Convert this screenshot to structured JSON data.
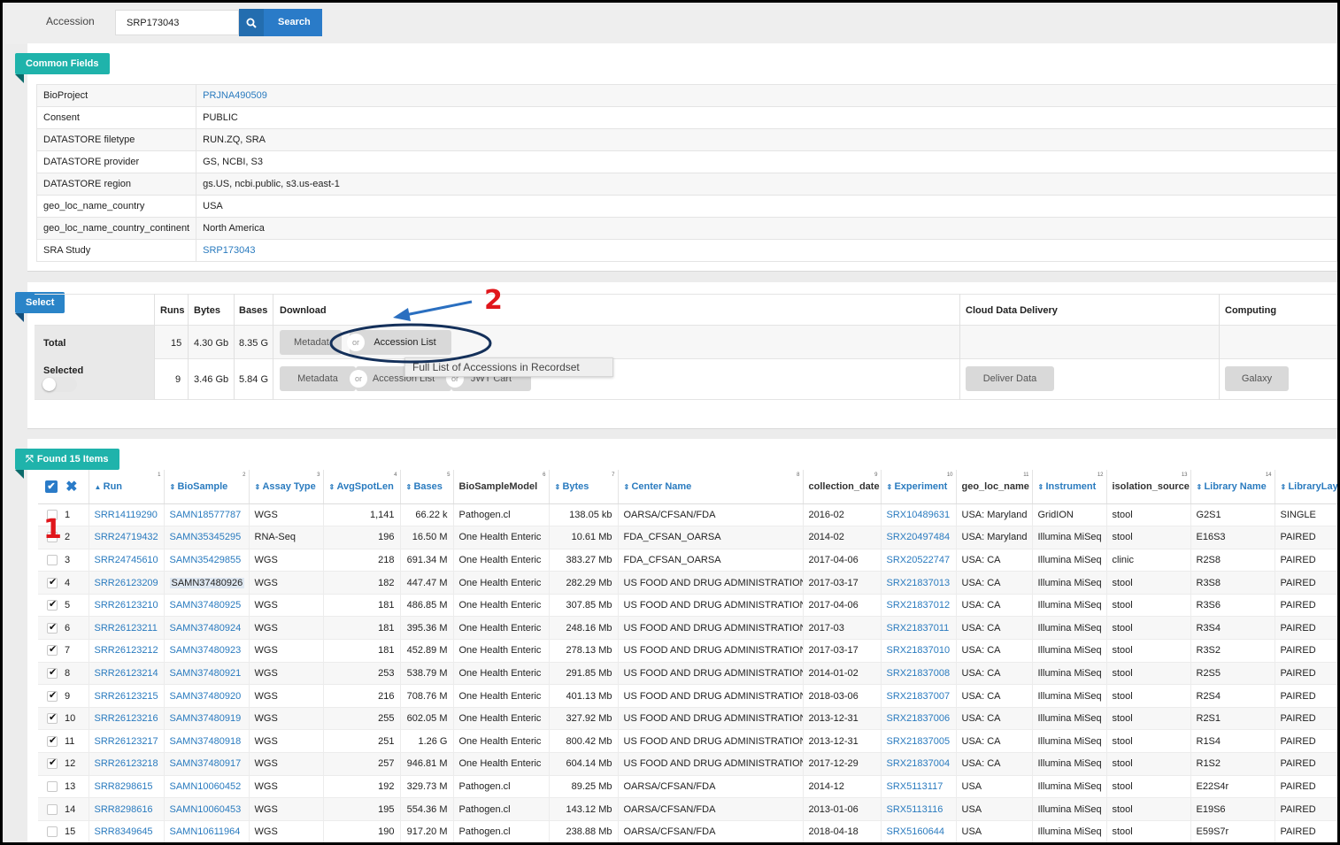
{
  "search": {
    "label": "Accession",
    "value": "SRP173043",
    "button": "Search"
  },
  "common_fields": {
    "title": "Common Fields",
    "rows": [
      {
        "key": "BioProject",
        "value": "PRJNA490509",
        "link": true
      },
      {
        "key": "Consent",
        "value": "PUBLIC",
        "link": false
      },
      {
        "key": "DATASTORE filetype",
        "value": "RUN.ZQ, SRA",
        "link": false
      },
      {
        "key": "DATASTORE provider",
        "value": "GS, NCBI, S3",
        "link": false
      },
      {
        "key": "DATASTORE region",
        "value": "gs.US, ncbi.public, s3.us-east-1",
        "link": false
      },
      {
        "key": "geo_loc_name_country",
        "value": "USA",
        "link": false
      },
      {
        "key": "geo_loc_name_country_continent",
        "value": "North America",
        "link": false
      },
      {
        "key": "SRA Study",
        "value": "SRP173043",
        "link": true
      }
    ]
  },
  "select": {
    "title": "Select",
    "headers": {
      "runs": "Runs",
      "bytes": "Bytes",
      "bases": "Bases",
      "download": "Download",
      "cloud": "Cloud Data Delivery",
      "computing": "Computing"
    },
    "total": {
      "label": "Total",
      "runs": "15",
      "bytes": "4.30 Gb",
      "bases": "8.35 G"
    },
    "selected": {
      "label": "Selected",
      "runs": "9",
      "bytes": "3.46 Gb",
      "bases": "5.84 G"
    },
    "buttons": {
      "metadata_total": "Metadat",
      "accession_total": "Accession List",
      "metadata": "Metadata",
      "accession": "Accession List",
      "jwt": "JWT Cart",
      "deliver": "Deliver Data",
      "galaxy": "Galaxy",
      "or": "or"
    },
    "tooltip": "Full List of Accessions in Recordset"
  },
  "annotations": {
    "one": "1",
    "two": "2"
  },
  "results": {
    "title": "Found 15 Items",
    "columns": [
      {
        "label": "Run",
        "n": "1"
      },
      {
        "label": "BioSample",
        "n": "2"
      },
      {
        "label": "Assay Type",
        "n": "3"
      },
      {
        "label": "AvgSpotLen",
        "n": "4"
      },
      {
        "label": "Bases",
        "n": "5"
      },
      {
        "label": "BioSampleModel",
        "n": "6"
      },
      {
        "label": "Bytes",
        "n": "7"
      },
      {
        "label": "Center Name",
        "n": "8"
      },
      {
        "label": "collection_date",
        "n": "9"
      },
      {
        "label": "Experiment",
        "n": "10"
      },
      {
        "label": "geo_loc_name",
        "n": "11"
      },
      {
        "label": "Instrument",
        "n": "12"
      },
      {
        "label": "isolation_source",
        "n": "13"
      },
      {
        "label": "Library Name",
        "n": "14"
      },
      {
        "label": "LibraryLay",
        "n": ""
      }
    ],
    "rows": [
      {
        "i": "1",
        "c": false,
        "run": "SRR14119290",
        "bs": "SAMN18577787",
        "assay": "WGS",
        "avg": "1,141",
        "bases": "66.22 k",
        "model": "Pathogen.cl",
        "bytes": "138.05 kb",
        "center": "OARSA/CFSAN/FDA",
        "date": "2016-02",
        "exp": "SRX10489631",
        "geo": "USA: Maryland",
        "inst": "GridION",
        "iso": "stool",
        "lib": "G2S1",
        "lay": "SINGLE"
      },
      {
        "i": "2",
        "c": false,
        "run": "SRR24719432",
        "bs": "SAMN35345295",
        "assay": "RNA-Seq",
        "avg": "196",
        "bases": "16.50 M",
        "model": "One Health Enteric",
        "bytes": "10.61 Mb",
        "center": "FDA_CFSAN_OARSA",
        "date": "2014-02",
        "exp": "SRX20497484",
        "geo": "USA: Maryland",
        "inst": "Illumina MiSeq",
        "iso": "stool",
        "lib": "E16S3",
        "lay": "PAIRED"
      },
      {
        "i": "3",
        "c": false,
        "run": "SRR24745610",
        "bs": "SAMN35429855",
        "assay": "WGS",
        "avg": "218",
        "bases": "691.34 M",
        "model": "One Health Enteric",
        "bytes": "383.27 Mb",
        "center": "FDA_CFSAN_OARSA",
        "date": "2017-04-06",
        "exp": "SRX20522747",
        "geo": "USA: CA",
        "inst": "Illumina MiSeq",
        "iso": "clinic",
        "lib": "R2S8",
        "lay": "PAIRED"
      },
      {
        "i": "4",
        "c": true,
        "run": "SRR26123209",
        "bs": "SAMN37480926",
        "assay": "WGS",
        "avg": "182",
        "bases": "447.47 M",
        "model": "One Health Enteric",
        "bytes": "282.29 Mb",
        "center": "US FOOD AND DRUG ADMINISTRATION",
        "date": "2017-03-17",
        "exp": "SRX21837013",
        "geo": "USA: CA",
        "inst": "Illumina MiSeq",
        "iso": "stool",
        "lib": "R3S8",
        "lay": "PAIRED"
      },
      {
        "i": "5",
        "c": true,
        "run": "SRR26123210",
        "bs": "SAMN37480925",
        "assay": "WGS",
        "avg": "181",
        "bases": "486.85 M",
        "model": "One Health Enteric",
        "bytes": "307.85 Mb",
        "center": "US FOOD AND DRUG ADMINISTRATION",
        "date": "2017-04-06",
        "exp": "SRX21837012",
        "geo": "USA: CA",
        "inst": "Illumina MiSeq",
        "iso": "stool",
        "lib": "R3S6",
        "lay": "PAIRED"
      },
      {
        "i": "6",
        "c": true,
        "run": "SRR26123211",
        "bs": "SAMN37480924",
        "assay": "WGS",
        "avg": "181",
        "bases": "395.36 M",
        "model": "One Health Enteric",
        "bytes": "248.16 Mb",
        "center": "US FOOD AND DRUG ADMINISTRATION",
        "date": "2017-03",
        "exp": "SRX21837011",
        "geo": "USA: CA",
        "inst": "Illumina MiSeq",
        "iso": "stool",
        "lib": "R3S4",
        "lay": "PAIRED"
      },
      {
        "i": "7",
        "c": true,
        "run": "SRR26123212",
        "bs": "SAMN37480923",
        "assay": "WGS",
        "avg": "181",
        "bases": "452.89 M",
        "model": "One Health Enteric",
        "bytes": "278.13 Mb",
        "center": "US FOOD AND DRUG ADMINISTRATION",
        "date": "2017-03-17",
        "exp": "SRX21837010",
        "geo": "USA: CA",
        "inst": "Illumina MiSeq",
        "iso": "stool",
        "lib": "R3S2",
        "lay": "PAIRED"
      },
      {
        "i": "8",
        "c": true,
        "run": "SRR26123214",
        "bs": "SAMN37480921",
        "assay": "WGS",
        "avg": "253",
        "bases": "538.79 M",
        "model": "One Health Enteric",
        "bytes": "291.85 Mb",
        "center": "US FOOD AND DRUG ADMINISTRATION",
        "date": "2014-01-02",
        "exp": "SRX21837008",
        "geo": "USA: CA",
        "inst": "Illumina MiSeq",
        "iso": "stool",
        "lib": "R2S5",
        "lay": "PAIRED"
      },
      {
        "i": "9",
        "c": true,
        "run": "SRR26123215",
        "bs": "SAMN37480920",
        "assay": "WGS",
        "avg": "216",
        "bases": "708.76 M",
        "model": "One Health Enteric",
        "bytes": "401.13 Mb",
        "center": "US FOOD AND DRUG ADMINISTRATION",
        "date": "2018-03-06",
        "exp": "SRX21837007",
        "geo": "USA: CA",
        "inst": "Illumina MiSeq",
        "iso": "stool",
        "lib": "R2S4",
        "lay": "PAIRED"
      },
      {
        "i": "10",
        "c": true,
        "run": "SRR26123216",
        "bs": "SAMN37480919",
        "assay": "WGS",
        "avg": "255",
        "bases": "602.05 M",
        "model": "One Health Enteric",
        "bytes": "327.92 Mb",
        "center": "US FOOD AND DRUG ADMINISTRATION",
        "date": "2013-12-31",
        "exp": "SRX21837006",
        "geo": "USA: CA",
        "inst": "Illumina MiSeq",
        "iso": "stool",
        "lib": "R2S1",
        "lay": "PAIRED"
      },
      {
        "i": "11",
        "c": true,
        "run": "SRR26123217",
        "bs": "SAMN37480918",
        "assay": "WGS",
        "avg": "251",
        "bases": "1.26 G",
        "model": "One Health Enteric",
        "bytes": "800.42 Mb",
        "center": "US FOOD AND DRUG ADMINISTRATION",
        "date": "2013-12-31",
        "exp": "SRX21837005",
        "geo": "USA: CA",
        "inst": "Illumina MiSeq",
        "iso": "stool",
        "lib": "R1S4",
        "lay": "PAIRED"
      },
      {
        "i": "12",
        "c": true,
        "run": "SRR26123218",
        "bs": "SAMN37480917",
        "assay": "WGS",
        "avg": "257",
        "bases": "946.81 M",
        "model": "One Health Enteric",
        "bytes": "604.14 Mb",
        "center": "US FOOD AND DRUG ADMINISTRATION",
        "date": "2017-12-29",
        "exp": "SRX21837004",
        "geo": "USA: CA",
        "inst": "Illumina MiSeq",
        "iso": "stool",
        "lib": "R1S2",
        "lay": "PAIRED"
      },
      {
        "i": "13",
        "c": false,
        "run": "SRR8298615",
        "bs": "SAMN10060452",
        "assay": "WGS",
        "avg": "192",
        "bases": "329.73 M",
        "model": "Pathogen.cl",
        "bytes": "89.25 Mb",
        "center": "OARSA/CFSAN/FDA",
        "date": "2014-12",
        "exp": "SRX5113117",
        "geo": "USA",
        "inst": "Illumina MiSeq",
        "iso": "stool",
        "lib": "E22S4r",
        "lay": "PAIRED"
      },
      {
        "i": "14",
        "c": false,
        "run": "SRR8298616",
        "bs": "SAMN10060453",
        "assay": "WGS",
        "avg": "195",
        "bases": "554.36 M",
        "model": "Pathogen.cl",
        "bytes": "143.12 Mb",
        "center": "OARSA/CFSAN/FDA",
        "date": "2013-01-06",
        "exp": "SRX5113116",
        "geo": "USA",
        "inst": "Illumina MiSeq",
        "iso": "stool",
        "lib": "E19S6",
        "lay": "PAIRED"
      },
      {
        "i": "15",
        "c": false,
        "run": "SRR8349645",
        "bs": "SAMN10611964",
        "assay": "WGS",
        "avg": "190",
        "bases": "917.20 M",
        "model": "Pathogen.cl",
        "bytes": "238.88 Mb",
        "center": "OARSA/CFSAN/FDA",
        "date": "2018-04-18",
        "exp": "SRX5160644",
        "geo": "USA",
        "inst": "Illumina MiSeq",
        "iso": "stool",
        "lib": "E59S7r",
        "lay": "PAIRED"
      }
    ]
  },
  "colors": {
    "teal": "#1fb3ab",
    "blue": "#2a84c8",
    "link": "#2a7bbf",
    "annotation_red": "#e0161b",
    "annotation_navy": "#14305a"
  }
}
